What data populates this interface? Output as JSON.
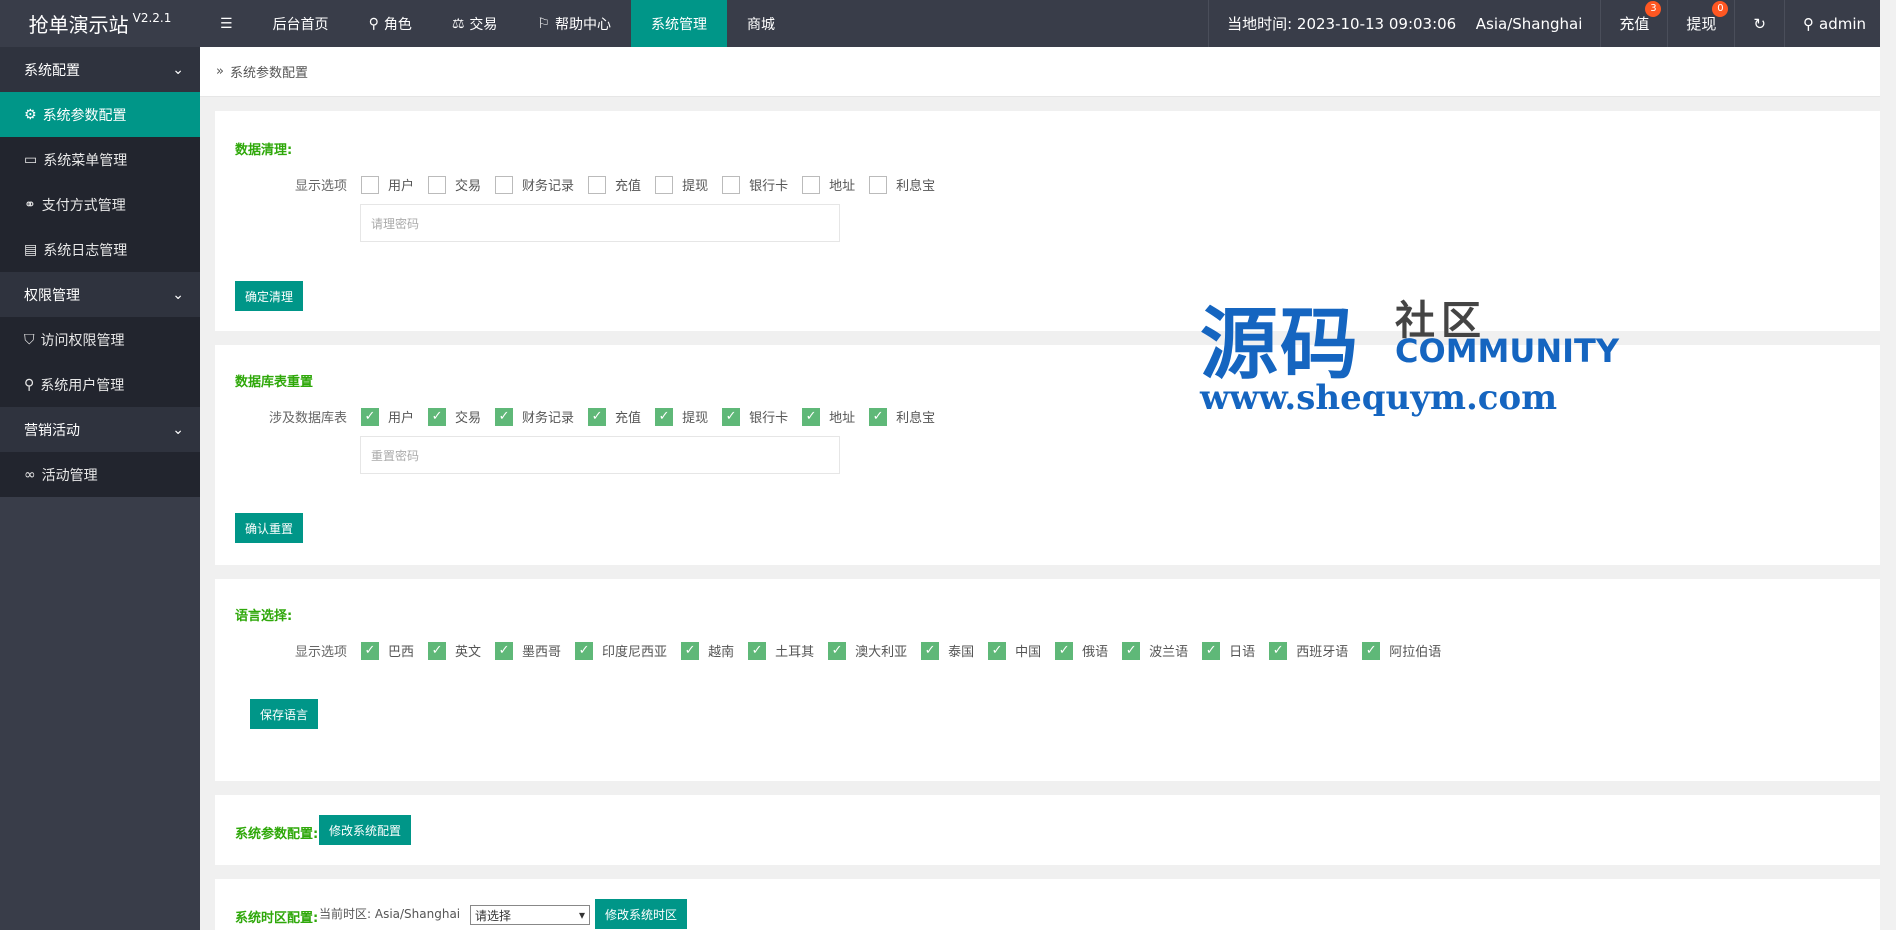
{
  "header": {
    "logo": "抢单演示站",
    "version": "V2.2.1",
    "nav": [
      {
        "label": "后台首页",
        "icon": ""
      },
      {
        "label": "角色",
        "icon": "user-icon"
      },
      {
        "label": "交易",
        "icon": "scale-icon"
      },
      {
        "label": "帮助中心",
        "icon": "flag-icon"
      },
      {
        "label": "系统管理",
        "icon": ""
      },
      {
        "label": "商城",
        "icon": ""
      }
    ],
    "time_label": "当地时间: 2023-10-13 09:03:06",
    "timezone": "Asia/Shanghai",
    "recharge": "充值",
    "recharge_count": "3",
    "withdraw": "提现",
    "withdraw_count": "0",
    "user": "admin"
  },
  "sidebar": {
    "groups": [
      {
        "label": "系统配置",
        "items": [
          "系统参数配置",
          "系统菜单管理",
          "支付方式管理",
          "系统日志管理"
        ]
      },
      {
        "label": "权限管理",
        "items": [
          "访问权限管理",
          "系统用户管理"
        ]
      },
      {
        "label": "营销活动",
        "items": [
          "活动管理"
        ]
      }
    ]
  },
  "breadcrumb": "系统参数配置",
  "clean": {
    "title": "数据清理:",
    "label": "显示选项",
    "options": [
      "用户",
      "交易",
      "财务记录",
      "充值",
      "提现",
      "银行卡",
      "地址",
      "利息宝"
    ],
    "placeholder": "请理密码",
    "button": "确定清理"
  },
  "reset": {
    "title": "数据库表重置",
    "label": "涉及数据库表",
    "options": [
      "用户",
      "交易",
      "财务记录",
      "充值",
      "提现",
      "银行卡",
      "地址",
      "利息宝"
    ],
    "placeholder": "重置密码",
    "button": "确认重置"
  },
  "lang": {
    "title": "语言选择:",
    "label": "显示选项",
    "options": [
      "巴西",
      "英文",
      "墨西哥",
      "印度尼西亚",
      "越南",
      "土耳其",
      "澳大利亚",
      "泰国",
      "中国",
      "俄语",
      "波兰语",
      "日语",
      "西班牙语",
      "阿拉伯语"
    ],
    "button": "保存语言"
  },
  "sysparam": {
    "title": "系统参数配置:",
    "button": "修改系统配置"
  },
  "timezone": {
    "title": "系统时区配置:",
    "current": "当前时区: Asia/Shanghai",
    "select": "请选择",
    "button": "修改系统时区"
  },
  "watermark": {
    "cn": "源码",
    "sq": "社区",
    "com": "COMMUNITY",
    "url": "www.shequym.com"
  }
}
